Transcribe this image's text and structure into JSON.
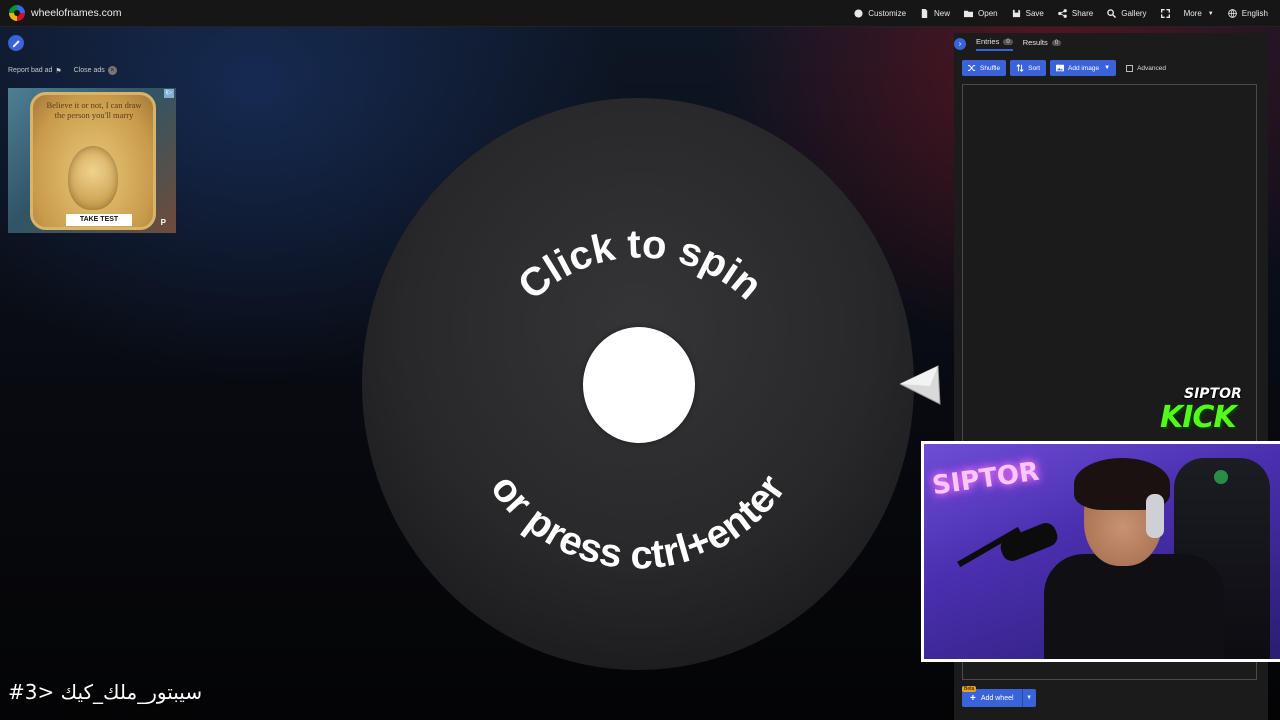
{
  "site": {
    "name": "wheelofnames.com"
  },
  "nav": [
    {
      "label": "Customize",
      "icon": "palette-icon"
    },
    {
      "label": "New",
      "icon": "new-file-icon"
    },
    {
      "label": "Open",
      "icon": "folder-open-icon"
    },
    {
      "label": "Save",
      "icon": "save-icon"
    },
    {
      "label": "Share",
      "icon": "share-icon"
    },
    {
      "label": "Gallery",
      "icon": "search-icon"
    },
    {
      "label": "",
      "icon": "fullscreen-icon"
    },
    {
      "label": "More",
      "icon": "caret-down-icon"
    },
    {
      "label": "English",
      "icon": "globe-icon"
    }
  ],
  "ad": {
    "report_label": "Report bad ad",
    "close_label": "Close ads",
    "headline": "Believe it or not, I can draw the person you'll marry",
    "cta": "TAKE TEST",
    "brand_mark": "P"
  },
  "wheel": {
    "top_text": "Click to spin",
    "bottom_text": "or press ctrl+enter"
  },
  "panel": {
    "tabs": [
      {
        "label": "Entries",
        "count": "0"
      },
      {
        "label": "Results",
        "count": "0"
      }
    ],
    "toolbar": {
      "shuffle": "Shuffle",
      "sort": "Sort",
      "add_image": "Add image",
      "advanced": "Advanced"
    },
    "add_wheel": {
      "label": "Add wheel",
      "badge": "Beta"
    }
  },
  "overlay": {
    "brand_name": "SIPTOR",
    "brand_kick": "KICK",
    "neon_sign": "SIPTOR",
    "caption": "#سيبتور_ملك_كيك <3"
  },
  "colors": {
    "accent": "#3a63d9",
    "kick_green": "#53fc18",
    "wheel_dark": "#2b2b2e"
  }
}
